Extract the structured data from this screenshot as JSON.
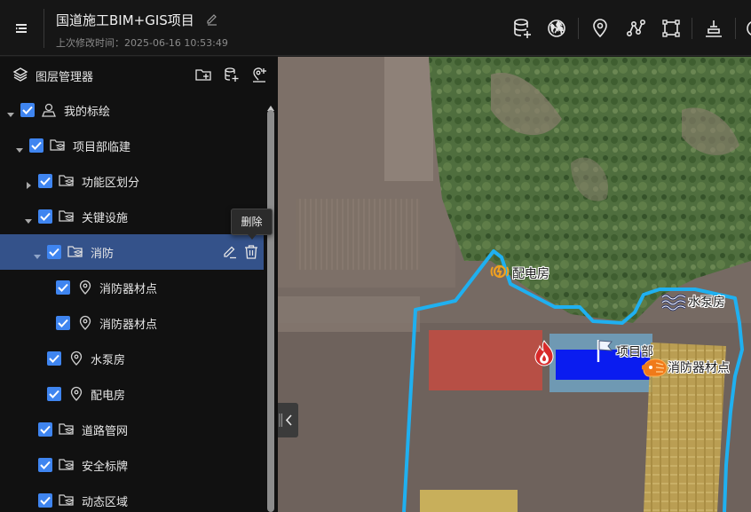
{
  "header": {
    "title": "国道施工BIM+GIS项目",
    "last_modified": "上次修改时间：2025-06-16 10:53:49"
  },
  "toolbar": {
    "tools": [
      "database-add-icon",
      "globe-icon",
      "location-pin-icon",
      "polyline-icon",
      "rectangle-icon",
      "level-icon",
      "compass-icon"
    ]
  },
  "layer_panel": {
    "title": "图层管理器",
    "header_actions": [
      "add-folder-icon",
      "add-data-layer-icon",
      "add-marker-icon"
    ],
    "tooltip": "删除",
    "tree": [
      {
        "label": "我的标绘",
        "type": "user",
        "expanded": true,
        "checked": true
      },
      {
        "label": "项目部临建",
        "type": "folder",
        "expanded": true,
        "checked": true
      },
      {
        "label": "功能区划分",
        "type": "folder",
        "expanded": false,
        "checked": true
      },
      {
        "label": "关键设施",
        "type": "folder",
        "expanded": true,
        "checked": true
      },
      {
        "label": "消防",
        "type": "folder",
        "expanded": true,
        "checked": true,
        "selected": true
      },
      {
        "label": "消防器材点",
        "type": "point",
        "checked": true
      },
      {
        "label": "消防器材点",
        "type": "point",
        "checked": true
      },
      {
        "label": "水泵房",
        "type": "point",
        "checked": true
      },
      {
        "label": "配电房",
        "type": "point",
        "checked": true
      },
      {
        "label": "道路管网",
        "type": "folder",
        "checked": true
      },
      {
        "label": "安全标牌",
        "type": "folder",
        "checked": true
      },
      {
        "label": "动态区域",
        "type": "folder",
        "checked": true
      }
    ]
  },
  "map": {
    "labels": {
      "power_room": "配电房",
      "pump_room": "水泵房",
      "project_dept": "项目部",
      "fire_equipment": "消防器材点"
    },
    "colors": {
      "boundary": "#1fb0f0",
      "red_zone": "#d04a3e",
      "blue_zone": "#0a1cf0",
      "light_blue_zone": "#6fb0d8",
      "yellow_zone": "#e8c24a"
    }
  }
}
